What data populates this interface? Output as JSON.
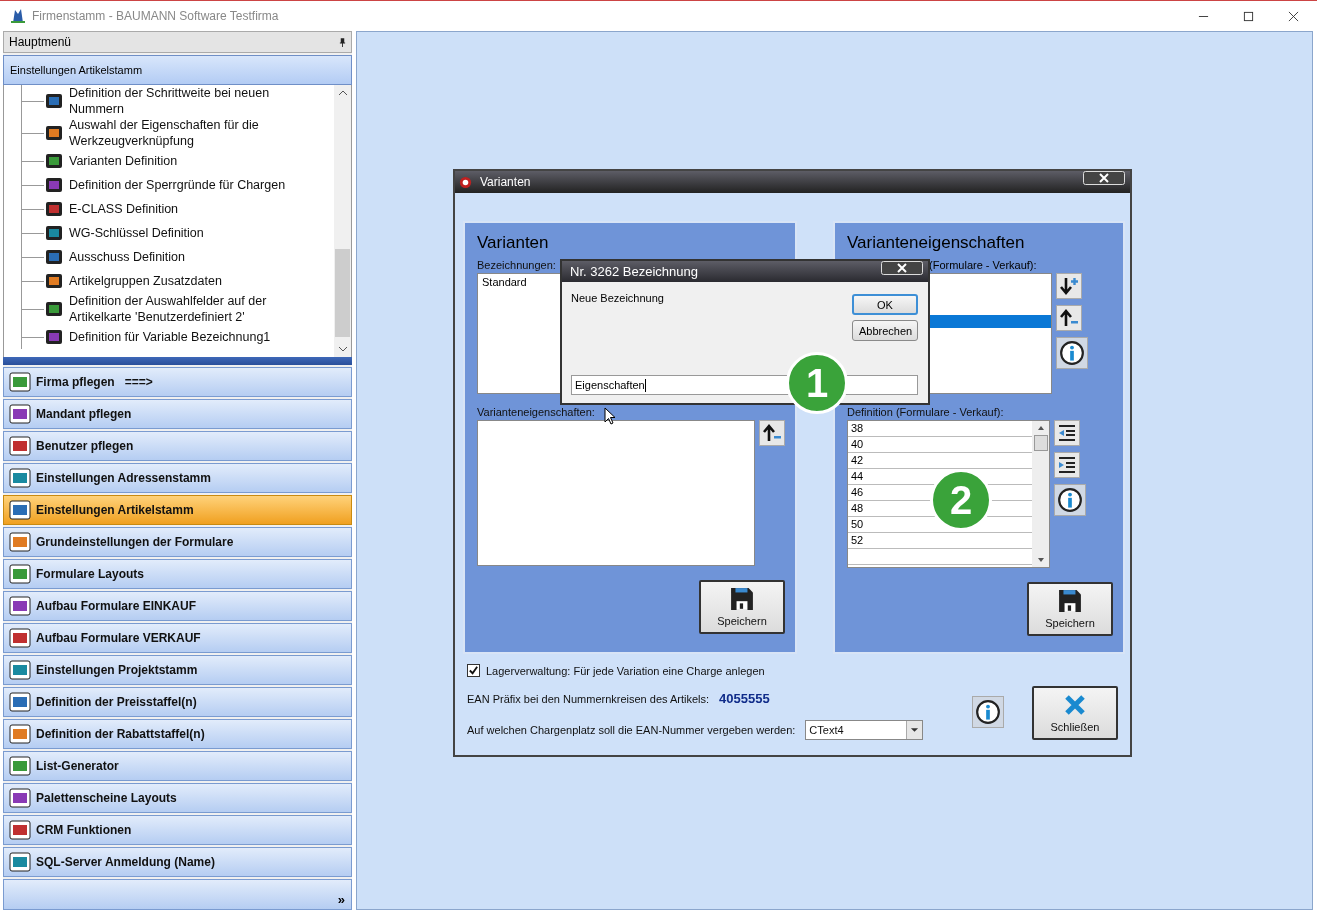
{
  "window": {
    "title": "Firmenstamm - BAUMANN Software Testfirma"
  },
  "sidebar": {
    "header": "Hauptmenü",
    "section": "Einstellungen Artikelstamm",
    "tree": [
      {
        "label": "Definition der Schrittweite bei neuen\nNummern"
      },
      {
        "label": "Auswahl der Eigenschaften für die\nWerkzeugverknüpfung"
      },
      {
        "label": "Varianten Definition"
      },
      {
        "label": "Definition der Sperrgründe für Chargen"
      },
      {
        "label": "E-CLASS Definition"
      },
      {
        "label": "WG-Schlüssel Definition"
      },
      {
        "label": "Ausschuss Definition"
      },
      {
        "label": "Artikelgruppen Zusatzdaten"
      },
      {
        "label": "Definition der Auswahlfelder auf der\nArtikelkarte 'Benutzerdefiniert 2'"
      },
      {
        "label": "Definition für Variable Bezeichnung1"
      }
    ],
    "items": [
      {
        "label": "Firma pflegen   ===>",
        "selected": false
      },
      {
        "label": "Mandant pflegen",
        "selected": false
      },
      {
        "label": "Benutzer pflegen",
        "selected": false
      },
      {
        "label": "Einstellungen Adressenstamm",
        "selected": false
      },
      {
        "label": "Einstellungen Artikelstamm",
        "selected": true
      },
      {
        "label": "Grundeinstellungen der Formulare",
        "selected": false
      },
      {
        "label": "Formulare Layouts",
        "selected": false
      },
      {
        "label": "Aufbau Formulare EINKAUF",
        "selected": false
      },
      {
        "label": "Aufbau Formulare VERKAUF",
        "selected": false
      },
      {
        "label": "Einstellungen Projektstamm",
        "selected": false
      },
      {
        "label": "Definition der Preisstaffel(n)",
        "selected": false
      },
      {
        "label": "Definition der Rabattstaffel(n)",
        "selected": false
      },
      {
        "label": "List-Generator",
        "selected": false
      },
      {
        "label": "Palettenscheine Layouts",
        "selected": false
      },
      {
        "label": "CRM Funktionen",
        "selected": false
      },
      {
        "label": "SQL-Server Anmeldung (Name)",
        "selected": false
      }
    ],
    "more": "»"
  },
  "varianten_dialog": {
    "title": "Varianten",
    "variants_panel": {
      "heading": "Varianten",
      "names_label": "Bezeichnungen:",
      "names": [
        "Standard"
      ],
      "properties_label": "Varianteneigenschaften:",
      "save": "Speichern"
    },
    "properties_panel": {
      "heading": "Varianteneigenschaften",
      "list_label": "(Formulare - Verkauf):",
      "list_rows": [
        {
          "selected": false
        },
        {
          "selected": false
        },
        {
          "selected": false
        },
        {
          "selected": true
        }
      ],
      "definition_label": "Definition (Formulare - Verkauf):",
      "definition_rows": [
        "38",
        "40",
        "42",
        "44",
        "46",
        "48",
        "50",
        "52"
      ],
      "save": "Speichern"
    },
    "stock_option": {
      "label": "Lagerverwaltung: Für jede Variation eine Charge anlegen",
      "checked": true
    },
    "ean_prefix": {
      "label": "EAN Präfix bei den Nummernkreisen des Artikels:",
      "value": "4055555"
    },
    "ean_slot": {
      "label": "Auf welchen Chargenplatz soll die EAN-Nummer vergeben werden:",
      "value": "CText4"
    },
    "close": "Schließen"
  },
  "name_dialog": {
    "title": "Nr. 3262 Bezeichnung",
    "prompt": "Neue Bezeichnung",
    "ok": "OK",
    "cancel": "Abbrechen",
    "value": "Eigenschaften"
  },
  "callouts": [
    "1",
    "2"
  ]
}
